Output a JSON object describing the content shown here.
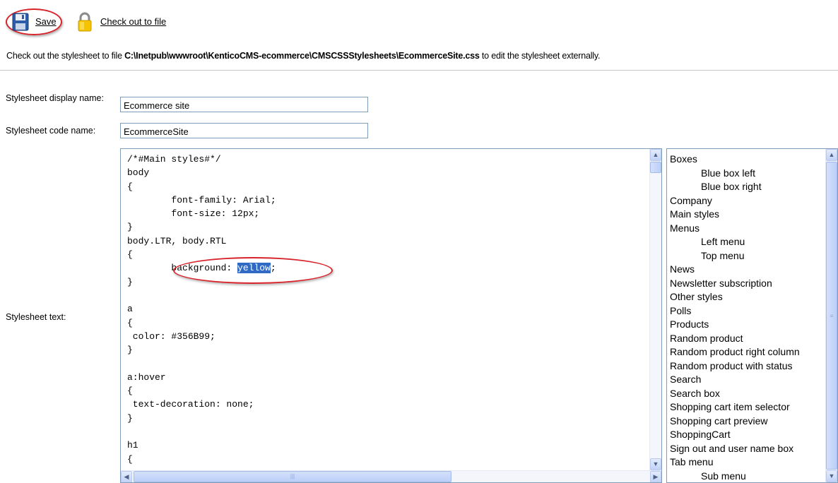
{
  "toolbar": {
    "save_label": "Save",
    "checkout_label": "Check out to file",
    "icons": {
      "save": "floppy-disk-icon",
      "checkout": "padlock-icon"
    }
  },
  "info": {
    "prefix": "Check out the stylesheet to file ",
    "path": "C:\\Inetpub\\wwwroot\\KenticoCMS-ecommerce\\CMSCSSStylesheets\\EcommerceSite.css",
    "suffix": " to edit the stylesheet externally."
  },
  "form": {
    "display_name_label": "Stylesheet display name:",
    "display_name_value": "Ecommerce site",
    "code_name_label": "Stylesheet code name:",
    "code_name_value": "EcommerceSite",
    "text_label": "Stylesheet text:"
  },
  "editor": {
    "lines_before": "/*#Main styles#*/\nbody\n{\n        font-family: Arial;\n        font-size: 12px;\n}\nbody.LTR, body.RTL\n{\n        background: ",
    "selected": "yellow",
    "lines_after": ";\n}\n\na\n{\n color: #356B99;\n}\n\na:hover\n{\n text-decoration: none;\n}\n\nh1\n{"
  },
  "style_list": [
    {
      "label": "Boxes",
      "indent": false
    },
    {
      "label": "Blue box left",
      "indent": true
    },
    {
      "label": "Blue box right",
      "indent": true
    },
    {
      "label": "Company",
      "indent": false
    },
    {
      "label": "Main styles",
      "indent": false
    },
    {
      "label": "Menus",
      "indent": false
    },
    {
      "label": "Left menu",
      "indent": true
    },
    {
      "label": "Top menu",
      "indent": true
    },
    {
      "label": "News",
      "indent": false
    },
    {
      "label": "Newsletter subscription",
      "indent": false
    },
    {
      "label": "Other styles",
      "indent": false
    },
    {
      "label": "Polls",
      "indent": false
    },
    {
      "label": "Products",
      "indent": false
    },
    {
      "label": "Random product",
      "indent": false
    },
    {
      "label": "Random product right column",
      "indent": false
    },
    {
      "label": "Random product with status",
      "indent": false
    },
    {
      "label": "Search",
      "indent": false
    },
    {
      "label": "Search box",
      "indent": false
    },
    {
      "label": "Shopping cart item selector",
      "indent": false
    },
    {
      "label": "Shopping cart preview",
      "indent": false
    },
    {
      "label": "ShoppingCart",
      "indent": false
    },
    {
      "label": "Sign out and user name box",
      "indent": false
    },
    {
      "label": "Tab menu",
      "indent": false
    },
    {
      "label": "Sub menu",
      "indent": true
    }
  ],
  "colors": {
    "annotation_ring": "#d8232a",
    "selection": "#316ac5",
    "border": "#7f9db9"
  }
}
